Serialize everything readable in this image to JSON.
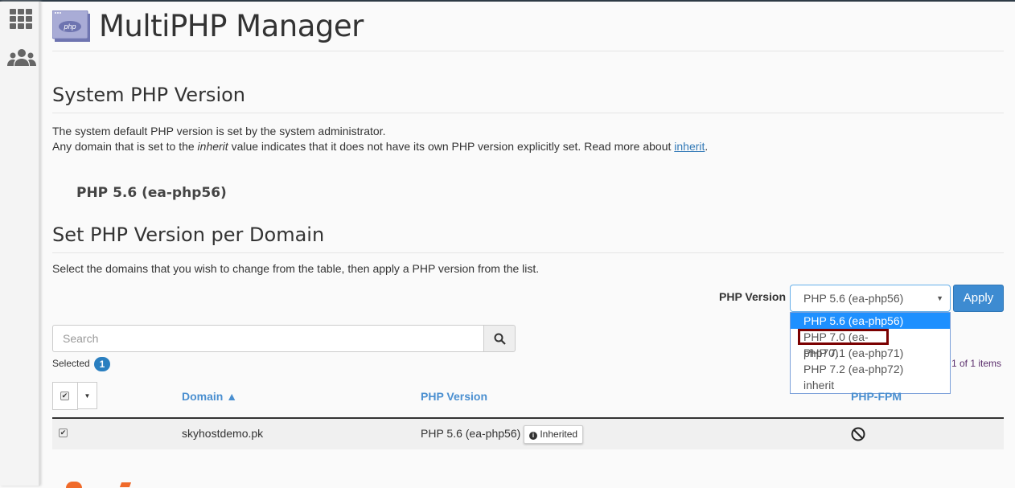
{
  "header": {
    "title": "MultiPHP Manager",
    "logo_text": "php"
  },
  "system": {
    "heading": "System PHP Version",
    "line1": "The system default PHP version is set by the system administrator.",
    "line2_a": "Any domain that is set to the ",
    "line2_em": "inherit",
    "line2_b": " value indicates that it does not have its own PHP version explicitly set. Read more about ",
    "line2_link": "inherit",
    "line2_end": ".",
    "version": "PHP 5.6 (ea-php56)"
  },
  "per_domain": {
    "heading": "Set PHP Version per Domain",
    "description": "Select the domains that you wish to change from the table, then apply a PHP version from the list.",
    "php_version_label": "PHP Version",
    "selected_value": "PHP 5.6 (ea-php56)",
    "apply_label": "Apply",
    "options": [
      "PHP 5.6 (ea-php56)",
      "PHP 7.0 (ea-php70)",
      "PHP 7.1 (ea-php71)",
      "PHP 7.2 (ea-php72)",
      "inherit"
    ],
    "highlighted_option": "PHP 5.6 (ea-php56)",
    "outlined_option": "PHP 7.0 (ea-php70)"
  },
  "search": {
    "placeholder": "Search"
  },
  "selected": {
    "label": "Selected",
    "count": "1"
  },
  "pagination": {
    "text": "1 of 1 items"
  },
  "table": {
    "columns": [
      "Domain ▲",
      "PHP Version",
      "PHP-FPM"
    ],
    "rows": [
      {
        "checked": true,
        "domain": "skyhostdemo.pk",
        "php_version": "PHP 5.6 (ea-php56)",
        "badge": "Inherited",
        "fpm": "disabled"
      }
    ]
  },
  "colors": {
    "accent": "#3d8bd1",
    "highlight": "#1e90ff",
    "outline": "#7b0000"
  }
}
